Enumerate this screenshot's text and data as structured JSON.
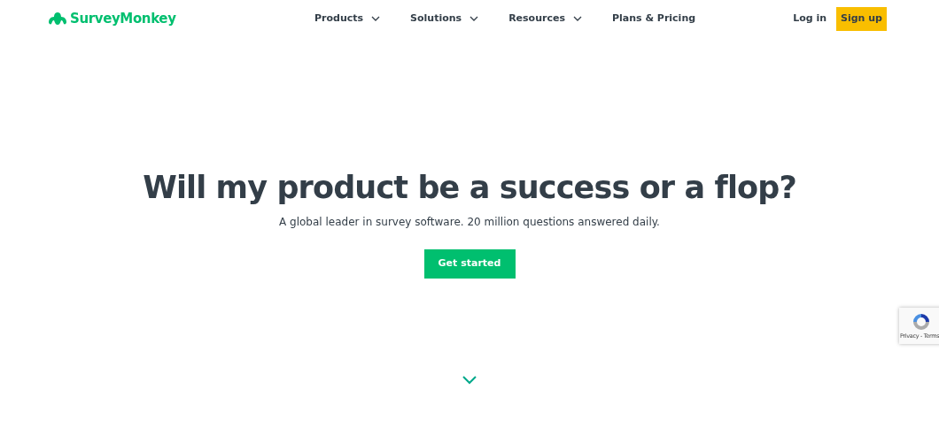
{
  "header": {
    "logo": "SurveyMonkey",
    "nav": [
      {
        "label": "Products",
        "dropdown": true
      },
      {
        "label": "Solutions",
        "dropdown": true
      },
      {
        "label": "Resources",
        "dropdown": true
      },
      {
        "label": "Plans & Pricing",
        "dropdown": false
      }
    ],
    "login": "Log in",
    "signup": "Sign up"
  },
  "hero": {
    "title": "Will my product be a success or a flop?",
    "subtitle": "A global leader in survey software. 20 million questions answered daily.",
    "cta": "Get started"
  },
  "recaptcha": {
    "links": "Privacy - Terms"
  }
}
